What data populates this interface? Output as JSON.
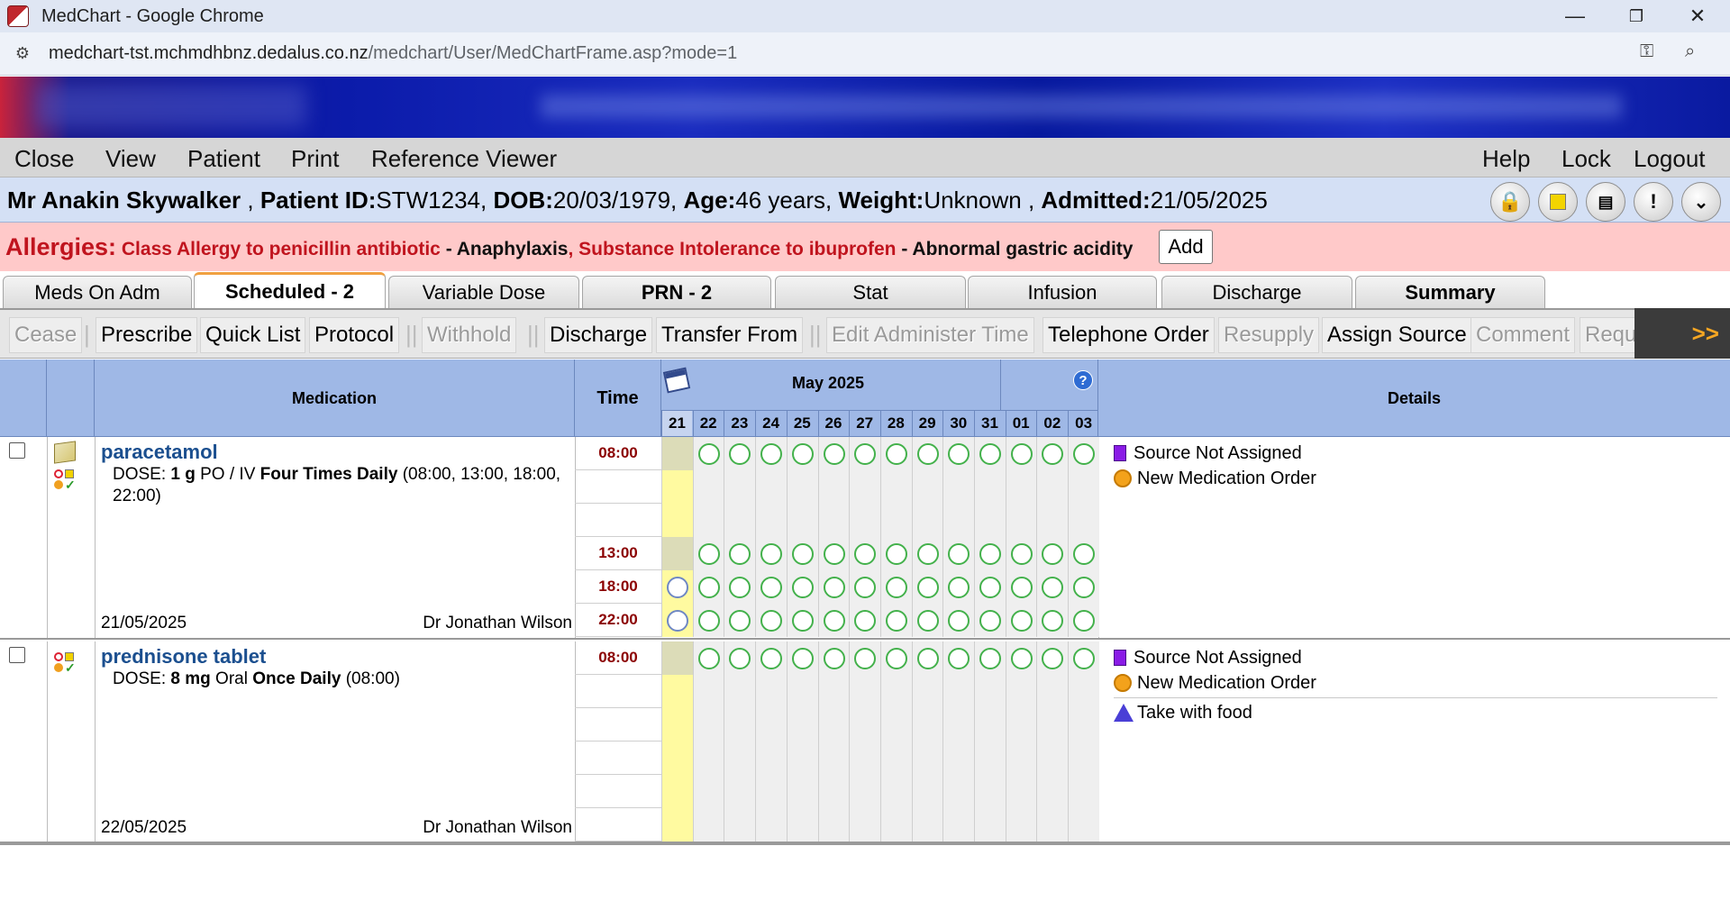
{
  "browser": {
    "title": "MedChart - Google Chrome",
    "url_host": "medchart-tst.mchmdhbnz.dedalus.co.nz",
    "url_path": "/medchart/User/MedChartFrame.asp?mode=1",
    "controls": {
      "minimize": "—",
      "restore": "❐",
      "close": "✕"
    }
  },
  "menu": {
    "left": [
      "Close",
      "View",
      "Patient",
      "Print",
      "Reference Viewer"
    ],
    "right": [
      "Help",
      "Lock",
      "Logout"
    ]
  },
  "patient": {
    "name": "Mr Anakin Skywalker",
    "id_label": "Patient ID:",
    "id": "STW1234",
    "dob_label": "DOB:",
    "dob": "20/03/1979",
    "age_label": "Age:",
    "age": "46 years",
    "weight_label": "Weight:",
    "weight": "Unknown",
    "admitted_label": "Admitted:",
    "admitted": "21/05/2025",
    "buttons": [
      "lock-icon",
      "yellow-square-icon",
      "chart-icon",
      "alert-icon",
      "expand-down-icon"
    ]
  },
  "allergies": {
    "label": "Allergies:",
    "a1": "Class Allergy to penicillin antibiotic",
    "a1_reaction": " - Anaphylaxis",
    "a2": ", Substance Intolerance to ibuprofen",
    "a2_reaction": " - Abnormal gastric acidity",
    "add": "Add"
  },
  "tabs": [
    "Meds On Adm",
    "Scheduled - 2",
    "Variable Dose",
    "PRN - 2",
    "Stat",
    "Infusion",
    "Discharge",
    "Summary"
  ],
  "active_tab": "Scheduled - 2",
  "toolbar": {
    "items": [
      "Cease",
      "Prescribe",
      "Quick List",
      "Protocol",
      "Withhold",
      "Discharge",
      "Transfer From",
      "Edit Administer Time",
      "Telephone Order",
      "Resupply",
      "Assign Source",
      "Comment",
      "Request Resup"
    ],
    "more": ">>"
  },
  "grid": {
    "medication_header": "Medication",
    "time_header": "Time",
    "month": "May 2025",
    "days": [
      "21",
      "22",
      "23",
      "24",
      "25",
      "26",
      "27",
      "28",
      "29",
      "30",
      "31",
      "01",
      "02",
      "03"
    ],
    "details_header": "Details"
  },
  "medications": [
    {
      "name": "paracetamol",
      "dose_prefix": "DOSE: ",
      "dose_amount": "1 g",
      "route": " PO / IV ",
      "frequency": "Four Times Daily",
      "times_text": " (08:00, 13:00, 18:00, 22:00)",
      "date": "21/05/2025",
      "doctor": "Dr Jonathan Wilson",
      "times": [
        "08:00",
        "",
        "",
        "13:00",
        "18:00",
        "22:00"
      ],
      "details": [
        "Source Not Assigned",
        "New Medication Order"
      ]
    },
    {
      "name": "prednisone tablet",
      "dose_prefix": "DOSE: ",
      "dose_amount": "8 mg",
      "route": " Oral ",
      "frequency": "Once Daily",
      "times_text": " (08:00)",
      "date": "22/05/2025",
      "doctor": "Dr Jonathan Wilson",
      "times": [
        "08:00",
        "",
        "",
        "",
        "",
        ""
      ],
      "details": [
        "Source Not Assigned",
        "New Medication Order"
      ],
      "notes": [
        "Take with food"
      ]
    }
  ]
}
